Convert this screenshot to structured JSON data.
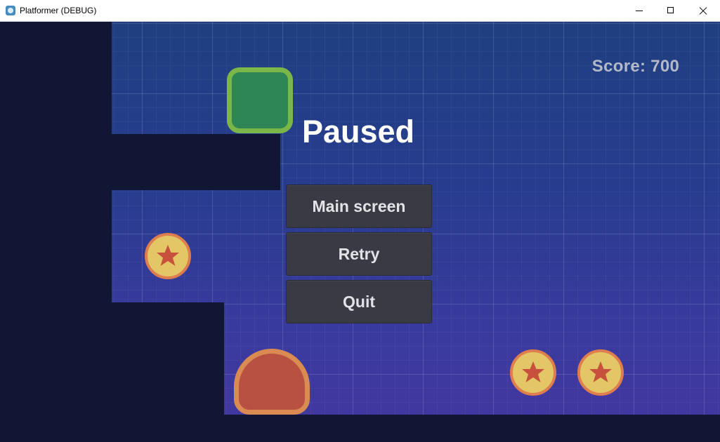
{
  "window": {
    "title": "Platformer (DEBUG)",
    "icon": "godot-icon",
    "controls": [
      "minimize-icon",
      "maximize-icon",
      "close-icon"
    ]
  },
  "hud": {
    "score_text": "Score: 700"
  },
  "pause_menu": {
    "title": "Paused",
    "buttons": {
      "main_screen": "Main screen",
      "retry": "Retry",
      "quit": "Quit"
    }
  },
  "scene": {
    "background_top": "#1f3f80",
    "background_bottom": "#44379f",
    "wall_color": "#111634",
    "player_fill": "#2e8555",
    "player_outline": "#7ab648",
    "coin_fill": "#e3c766",
    "coin_outline": "#de7e4e",
    "star_color": "#c7513d",
    "enemy_fill": "#b85141",
    "enemy_outline": "#d98b52",
    "coin_count": 3,
    "enemy_count": 1
  }
}
